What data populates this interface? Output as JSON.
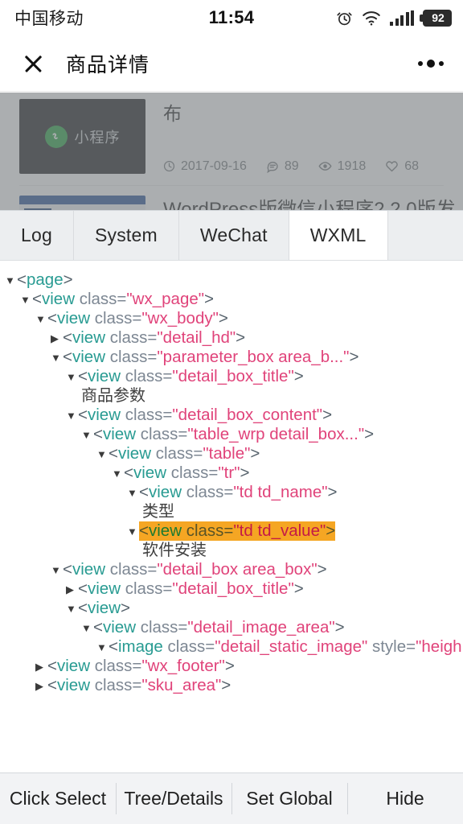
{
  "status_bar": {
    "carrier": "中国移动",
    "time": "11:54",
    "battery_percent": "92",
    "icons": [
      "alarm-clock-icon",
      "wifi-icon",
      "cellular-signal-icon",
      "battery-icon"
    ]
  },
  "nav_bar": {
    "close_label": "×",
    "title": "商品详情",
    "more_label": "•••"
  },
  "page_content": {
    "card1": {
      "thumb_label": "小程序",
      "title": "布",
      "meta": {
        "date": "2017-09-16",
        "comments": "89",
        "views": "1918",
        "likes": "68"
      }
    },
    "card2": {
      "title": "WordPress版微信小程序2.2.0版发"
    }
  },
  "devtools": {
    "tabs": [
      {
        "label": "Log",
        "active": false
      },
      {
        "label": "System",
        "active": false
      },
      {
        "label": "WeChat",
        "active": false
      },
      {
        "label": "WXML",
        "active": true
      }
    ],
    "tree": [
      {
        "depth": 0,
        "arrow": "down",
        "type": "element",
        "tag": "page"
      },
      {
        "depth": 1,
        "arrow": "down",
        "type": "element",
        "tag": "view",
        "attr": "class",
        "value": "wx_page"
      },
      {
        "depth": 2,
        "arrow": "down",
        "type": "element",
        "tag": "view",
        "attr": "class",
        "value": "wx_body"
      },
      {
        "depth": 3,
        "arrow": "right",
        "type": "element",
        "tag": "view",
        "attr": "class",
        "value": "detail_hd"
      },
      {
        "depth": 3,
        "arrow": "down",
        "type": "element",
        "tag": "view",
        "attr": "class",
        "value": "parameter_box area_b..."
      },
      {
        "depth": 4,
        "arrow": "down",
        "type": "element",
        "tag": "view",
        "attr": "class",
        "value": "detail_box_title"
      },
      {
        "depth": 5,
        "arrow": "none",
        "type": "text",
        "text": "商品参数"
      },
      {
        "depth": 4,
        "arrow": "down",
        "type": "element",
        "tag": "view",
        "attr": "class",
        "value": "detail_box_content"
      },
      {
        "depth": 5,
        "arrow": "down",
        "type": "element",
        "tag": "view",
        "attr": "class",
        "value": "table_wrp detail_box..."
      },
      {
        "depth": 6,
        "arrow": "down",
        "type": "element",
        "tag": "view",
        "attr": "class",
        "value": "table"
      },
      {
        "depth": 7,
        "arrow": "down",
        "type": "element",
        "tag": "view",
        "attr": "class",
        "value": "tr"
      },
      {
        "depth": 8,
        "arrow": "down",
        "type": "element",
        "tag": "view",
        "attr": "class",
        "value": "td td_name"
      },
      {
        "depth": 9,
        "arrow": "none",
        "type": "text",
        "text": "类型"
      },
      {
        "depth": 8,
        "arrow": "down",
        "type": "element",
        "tag": "view",
        "attr": "class",
        "value": "td td_value",
        "highlighted": true
      },
      {
        "depth": 9,
        "arrow": "none",
        "type": "text",
        "text": "软件安装"
      },
      {
        "depth": 3,
        "arrow": "down",
        "type": "element",
        "tag": "view",
        "attr": "class",
        "value": "detail_box area_box"
      },
      {
        "depth": 4,
        "arrow": "right",
        "type": "element",
        "tag": "view",
        "attr": "class",
        "value": "detail_box_title"
      },
      {
        "depth": 4,
        "arrow": "down",
        "type": "element",
        "tag": "view"
      },
      {
        "depth": 5,
        "arrow": "down",
        "type": "element",
        "tag": "view",
        "attr": "class",
        "value": "detail_image_area"
      },
      {
        "depth": 6,
        "arrow": "down",
        "type": "element",
        "tag": "image",
        "attr": "class",
        "value": "detail_static_image",
        "attr2": "style",
        "value2": "heigh",
        "clipped": true
      },
      {
        "depth": 2,
        "arrow": "right",
        "type": "element",
        "tag": "view",
        "attr": "class",
        "value": "wx_footer"
      },
      {
        "depth": 2,
        "arrow": "right",
        "type": "element",
        "tag": "view",
        "attr": "class",
        "value": "sku_area"
      }
    ],
    "bottom_buttons": [
      {
        "label": "Click Select"
      },
      {
        "label": "Tree/Details"
      },
      {
        "label": "Set Global"
      },
      {
        "label": "Hide"
      }
    ]
  },
  "colors": {
    "tag": "#289b92",
    "attribute": "#7d8793",
    "value": "#e0437a",
    "punctuation": "#55616b",
    "highlight": "#f5a623",
    "tab_bar_bg": "#eceef0",
    "bottom_bar_bg": "#f2f3f5",
    "mini_program_green": "#2ba245"
  }
}
